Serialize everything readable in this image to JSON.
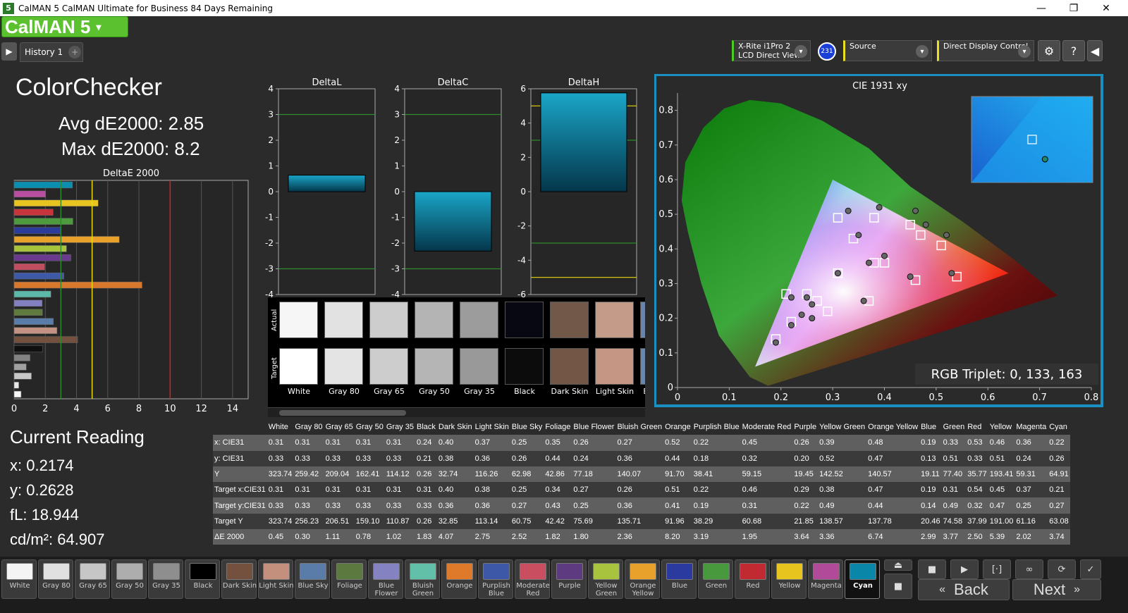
{
  "window": {
    "title": "CalMAN 5 CalMAN Ultimate for Business 84 Days Remaining",
    "app_badge": "5",
    "minimize": "—",
    "maximize": "❐",
    "close": "✕"
  },
  "logo": {
    "text": "CalMAN 5",
    "arrow": "▾"
  },
  "tabs": {
    "history_label": "History 1",
    "add": "+",
    "play": "▶"
  },
  "devices": {
    "meter_line1": "X-Rite i1Pro 2",
    "meter_line2": "LCD Direct View",
    "meter_badge": "231",
    "source_label": "Source",
    "display_label": "Direct Display Control",
    "arrow": "▾"
  },
  "toolbar_icons": [
    "gear-icon",
    "help-icon",
    "collapse-icon"
  ],
  "toolbar_glyphs": {
    "gear": "⚙",
    "help": "?",
    "collapse": "◀"
  },
  "main": {
    "title": "ColorChecker",
    "avg": "Avg dE2000: 2.85",
    "max": "Max dE2000: 8.2"
  },
  "current_reading": {
    "title": "Current Reading",
    "x": "x: 0.2174",
    "y": "y: 0.2628",
    "fl": "fL: 18.944",
    "cd": "cd/m²: 64.907"
  },
  "chart_data": [
    {
      "type": "bar",
      "title": "DeltaE 2000",
      "orientation": "horizontal",
      "xlim": [
        0,
        15
      ],
      "xticks": [
        0,
        2,
        4,
        6,
        8,
        10,
        12,
        14
      ],
      "reference_lines": [
        {
          "value": 3,
          "color": "#2e8b2e"
        },
        {
          "value": 5,
          "color": "#e8d80c"
        },
        {
          "value": 10,
          "color": "#d81e1e"
        }
      ],
      "categories": [
        "Cyan",
        "Magenta",
        "Yellow",
        "Red",
        "Green",
        "Blue",
        "Yellow Orange",
        "Yellow Green",
        "Purple",
        "Moderate Red",
        "Purplish Blue",
        "Orange",
        "Bluish Green",
        "Blue Flower",
        "Foliage",
        "Blue Sky",
        "Light Skin",
        "Dark Skin",
        "Black",
        "Gray 35",
        "Gray 50",
        "Gray 65",
        "Gray 80",
        "White"
      ],
      "values": [
        3.74,
        2.02,
        5.39,
        2.5,
        3.77,
        2.99,
        6.74,
        3.36,
        3.64,
        1.95,
        3.19,
        8.2,
        2.36,
        1.8,
        1.82,
        2.52,
        2.75,
        4.07,
        1.83,
        1.02,
        0.78,
        1.11,
        0.3,
        0.45
      ],
      "colors": [
        "#0a8fb0",
        "#b94ea0",
        "#e8c420",
        "#c8343c",
        "#4e9a3e",
        "#2c3c9a",
        "#e8a22c",
        "#a8c43c",
        "#6a3a8e",
        "#c04e60",
        "#3e5aa6",
        "#d8782c",
        "#5cb8a8",
        "#8280c0",
        "#5e7a3c",
        "#5a7ca8",
        "#c49282",
        "#74503e",
        "#101010",
        "#828282",
        "#a0a0a0",
        "#c8c8c8",
        "#e8e8e8",
        "#f8f8f8"
      ]
    },
    {
      "type": "bar",
      "title": "DeltaL",
      "ylim": [
        -4,
        4
      ],
      "yticks": [
        4,
        3,
        2,
        1,
        0,
        -1,
        -2,
        -3,
        -4
      ],
      "values": [
        0.64
      ],
      "reference_lines": [
        3,
        -3
      ]
    },
    {
      "type": "bar",
      "title": "DeltaC",
      "ylim": [
        -4,
        4
      ],
      "yticks": [
        4,
        3,
        2,
        1,
        0,
        -1,
        -2,
        -3,
        -4
      ],
      "values": [
        -2.31
      ],
      "reference_lines": [
        3,
        -3
      ]
    },
    {
      "type": "bar",
      "title": "DeltaH",
      "ylim": [
        -6,
        6
      ],
      "yticks": [
        6,
        4,
        2,
        0,
        -2,
        -4,
        -6
      ],
      "values": [
        5.76
      ],
      "reference_lines": [
        {
          "value": 5,
          "color": "#e8d80c"
        },
        {
          "value": 3,
          "color": "#2e8b2e"
        },
        {
          "value": -3,
          "color": "#2e8b2e"
        },
        {
          "value": -5,
          "color": "#e8d80c"
        }
      ]
    },
    {
      "type": "scatter",
      "title": "CIE 1931 xy",
      "xlim": [
        0,
        0.8
      ],
      "ylim": [
        0,
        0.85
      ],
      "xticks": [
        0,
        0.1,
        0.2,
        0.3,
        0.4,
        0.5,
        0.6,
        0.7,
        0.8
      ],
      "yticks": [
        0,
        0.1,
        0.2,
        0.3,
        0.4,
        0.5,
        0.6,
        0.7,
        0.8
      ],
      "gamut": [
        [
          0.64,
          0.33
        ],
        [
          0.3,
          0.6
        ],
        [
          0.15,
          0.06
        ]
      ],
      "targets": [
        [
          0.31,
          0.33
        ],
        [
          0.4,
          0.36
        ],
        [
          0.38,
          0.36
        ],
        [
          0.25,
          0.27
        ],
        [
          0.34,
          0.43
        ],
        [
          0.27,
          0.25
        ],
        [
          0.51,
          0.41
        ],
        [
          0.22,
          0.19
        ],
        [
          0.46,
          0.31
        ],
        [
          0.29,
          0.22
        ],
        [
          0.38,
          0.49
        ],
        [
          0.47,
          0.44
        ],
        [
          0.19,
          0.14
        ],
        [
          0.31,
          0.49
        ],
        [
          0.54,
          0.32
        ],
        [
          0.45,
          0.47
        ],
        [
          0.37,
          0.25
        ],
        [
          0.21,
          0.27
        ]
      ],
      "actuals": [
        [
          0.31,
          0.33
        ],
        [
          0.4,
          0.38
        ],
        [
          0.37,
          0.36
        ],
        [
          0.25,
          0.26
        ],
        [
          0.35,
          0.44
        ],
        [
          0.26,
          0.24
        ],
        [
          0.52,
          0.44
        ],
        [
          0.22,
          0.18
        ],
        [
          0.45,
          0.32
        ],
        [
          0.26,
          0.2
        ],
        [
          0.39,
          0.52
        ],
        [
          0.48,
          0.47
        ],
        [
          0.19,
          0.13
        ],
        [
          0.33,
          0.51
        ],
        [
          0.53,
          0.33
        ],
        [
          0.46,
          0.51
        ],
        [
          0.36,
          0.25
        ],
        [
          0.22,
          0.26
        ],
        [
          0.24,
          0.21
        ]
      ],
      "inset": {
        "target": [
          0.22,
          0.27
        ],
        "actual": [
          0.2174,
          0.2628
        ]
      },
      "readout": "RGB Triplet: 0, 133, 163"
    }
  ],
  "patches": {
    "actual_label": "Actual",
    "target_label": "Target",
    "items": [
      {
        "name": "White",
        "actual": "#f6f6f6",
        "target": "#ffffff"
      },
      {
        "name": "Gray 80",
        "actual": "#e2e2e2",
        "target": "#e4e4e4"
      },
      {
        "name": "Gray 65",
        "actual": "#cdcdcd",
        "target": "#cdcdcd"
      },
      {
        "name": "Gray 50",
        "actual": "#b4b4b4",
        "target": "#b5b5b5"
      },
      {
        "name": "Gray 35",
        "actual": "#9c9c9c",
        "target": "#999999"
      },
      {
        "name": "Black",
        "actual": "#070812",
        "target": "#0c0c0c"
      },
      {
        "name": "Dark Skin",
        "actual": "#725848",
        "target": "#735646"
      },
      {
        "name": "Light Skin",
        "actual": "#c49a88",
        "target": "#c69684"
      },
      {
        "name": "Blue Sky",
        "actual": "#6a84ac",
        "target": "#6886ae"
      }
    ]
  },
  "table": {
    "columns": [
      "White",
      "Gray 80",
      "Gray 65",
      "Gray 50",
      "Gray 35",
      "Black",
      "Dark Skin",
      "Light Skin",
      "Blue Sky",
      "Foliage",
      "Blue Flower",
      "Bluish Green",
      "Orange",
      "Purplish Blue",
      "Moderate Red",
      "Purple",
      "Yellow Green",
      "Orange Yellow",
      "Blue",
      "Green",
      "Red",
      "Yellow",
      "Magenta",
      "Cyan"
    ],
    "rows": [
      {
        "label": "x: CIE31",
        "values": [
          "0.31",
          "0.31",
          "0.31",
          "0.31",
          "0.31",
          "0.24",
          "0.40",
          "0.37",
          "0.25",
          "0.35",
          "0.26",
          "0.27",
          "0.52",
          "0.22",
          "0.45",
          "0.26",
          "0.39",
          "0.48",
          "0.19",
          "0.33",
          "0.53",
          "0.46",
          "0.36",
          "0.22"
        ]
      },
      {
        "label": "y: CIE31",
        "values": [
          "0.33",
          "0.33",
          "0.33",
          "0.33",
          "0.33",
          "0.21",
          "0.38",
          "0.36",
          "0.26",
          "0.44",
          "0.24",
          "0.36",
          "0.44",
          "0.18",
          "0.32",
          "0.20",
          "0.52",
          "0.47",
          "0.13",
          "0.51",
          "0.33",
          "0.51",
          "0.24",
          "0.26"
        ]
      },
      {
        "label": "Y",
        "values": [
          "323.74",
          "259.42",
          "209.04",
          "162.41",
          "114.12",
          "0.26",
          "32.74",
          "116.26",
          "62.98",
          "42.86",
          "77.18",
          "140.07",
          "91.70",
          "38.41",
          "59.15",
          "19.45",
          "142.52",
          "140.57",
          "19.11",
          "77.40",
          "35.77",
          "193.41",
          "59.31",
          "64.91"
        ]
      },
      {
        "label": "Target x:CIE31",
        "values": [
          "0.31",
          "0.31",
          "0.31",
          "0.31",
          "0.31",
          "0.31",
          "0.40",
          "0.38",
          "0.25",
          "0.34",
          "0.27",
          "0.26",
          "0.51",
          "0.22",
          "0.46",
          "0.29",
          "0.38",
          "0.47",
          "0.19",
          "0.31",
          "0.54",
          "0.45",
          "0.37",
          "0.21"
        ]
      },
      {
        "label": "Target y:CIE31",
        "values": [
          "0.33",
          "0.33",
          "0.33",
          "0.33",
          "0.33",
          "0.33",
          "0.36",
          "0.36",
          "0.27",
          "0.43",
          "0.25",
          "0.36",
          "0.41",
          "0.19",
          "0.31",
          "0.22",
          "0.49",
          "0.44",
          "0.14",
          "0.49",
          "0.32",
          "0.47",
          "0.25",
          "0.27"
        ]
      },
      {
        "label": "Target Y",
        "values": [
          "323.74",
          "256.23",
          "206.51",
          "159.10",
          "110.87",
          "0.26",
          "32.85",
          "113.14",
          "60.75",
          "42.42",
          "75.69",
          "135.71",
          "91.96",
          "38.29",
          "60.68",
          "21.85",
          "138.57",
          "137.78",
          "20.46",
          "74.58",
          "37.99",
          "191.00",
          "61.16",
          "63.08"
        ]
      },
      {
        "label": "ΔE 2000",
        "values": [
          "0.45",
          "0.30",
          "1.11",
          "0.78",
          "1.02",
          "1.83",
          "4.07",
          "2.75",
          "2.52",
          "1.82",
          "1.80",
          "2.36",
          "8.20",
          "3.19",
          "1.95",
          "3.64",
          "3.36",
          "6.74",
          "2.99",
          "3.77",
          "2.50",
          "5.39",
          "2.02",
          "3.74"
        ]
      }
    ]
  },
  "bottom": {
    "buttons": [
      {
        "label": "White",
        "color": "#f4f4f4"
      },
      {
        "label": "Gray 80",
        "color": "#e0e0e0"
      },
      {
        "label": "Gray 65",
        "color": "#c6c6c6"
      },
      {
        "label": "Gray 50",
        "color": "#adadad"
      },
      {
        "label": "Gray 35",
        "color": "#8e8e8e"
      },
      {
        "label": "Black",
        "color": "#000000"
      },
      {
        "label": "Dark Skin",
        "color": "#74503e"
      },
      {
        "label": "Light Skin",
        "color": "#c4907e"
      },
      {
        "label": "Blue Sky",
        "color": "#5a7ca8"
      },
      {
        "label": "Foliage",
        "color": "#5c7a40"
      },
      {
        "label": "Blue Flower",
        "color": "#8482c0"
      },
      {
        "label": "Bluish Green",
        "color": "#62c0a8"
      },
      {
        "label": "Orange",
        "color": "#de7a2a"
      },
      {
        "label": "Purplish Blue",
        "color": "#3e58a8"
      },
      {
        "label": "Moderate Red",
        "color": "#c84e60"
      },
      {
        "label": "Purple",
        "color": "#5e3a80"
      },
      {
        "label": "Yellow Green",
        "color": "#a8c43e"
      },
      {
        "label": "Orange Yellow",
        "color": "#e8a22c"
      },
      {
        "label": "Blue",
        "color": "#2a3a9e"
      },
      {
        "label": "Green",
        "color": "#48983e"
      },
      {
        "label": "Red",
        "color": "#c02a30"
      },
      {
        "label": "Yellow",
        "color": "#e8c41e"
      },
      {
        "label": "Magenta",
        "color": "#b24a9a"
      },
      {
        "label": "Cyan",
        "color": "#0a86a8"
      }
    ],
    "active": "Cyan",
    "controls": {
      "eject": "⏏",
      "stop": "■",
      "play": "▶",
      "meas": "[·]",
      "loop": "∞",
      "refresh": "⟳",
      "check": "✓",
      "stopbig": "■"
    },
    "back": "Back",
    "next": "Next",
    "back_icon": "«",
    "next_icon": "»"
  },
  "colors": {
    "accent_green": "#5cc12e",
    "panel_border": "#1b8fc0",
    "bar": "#0a8fb0"
  }
}
